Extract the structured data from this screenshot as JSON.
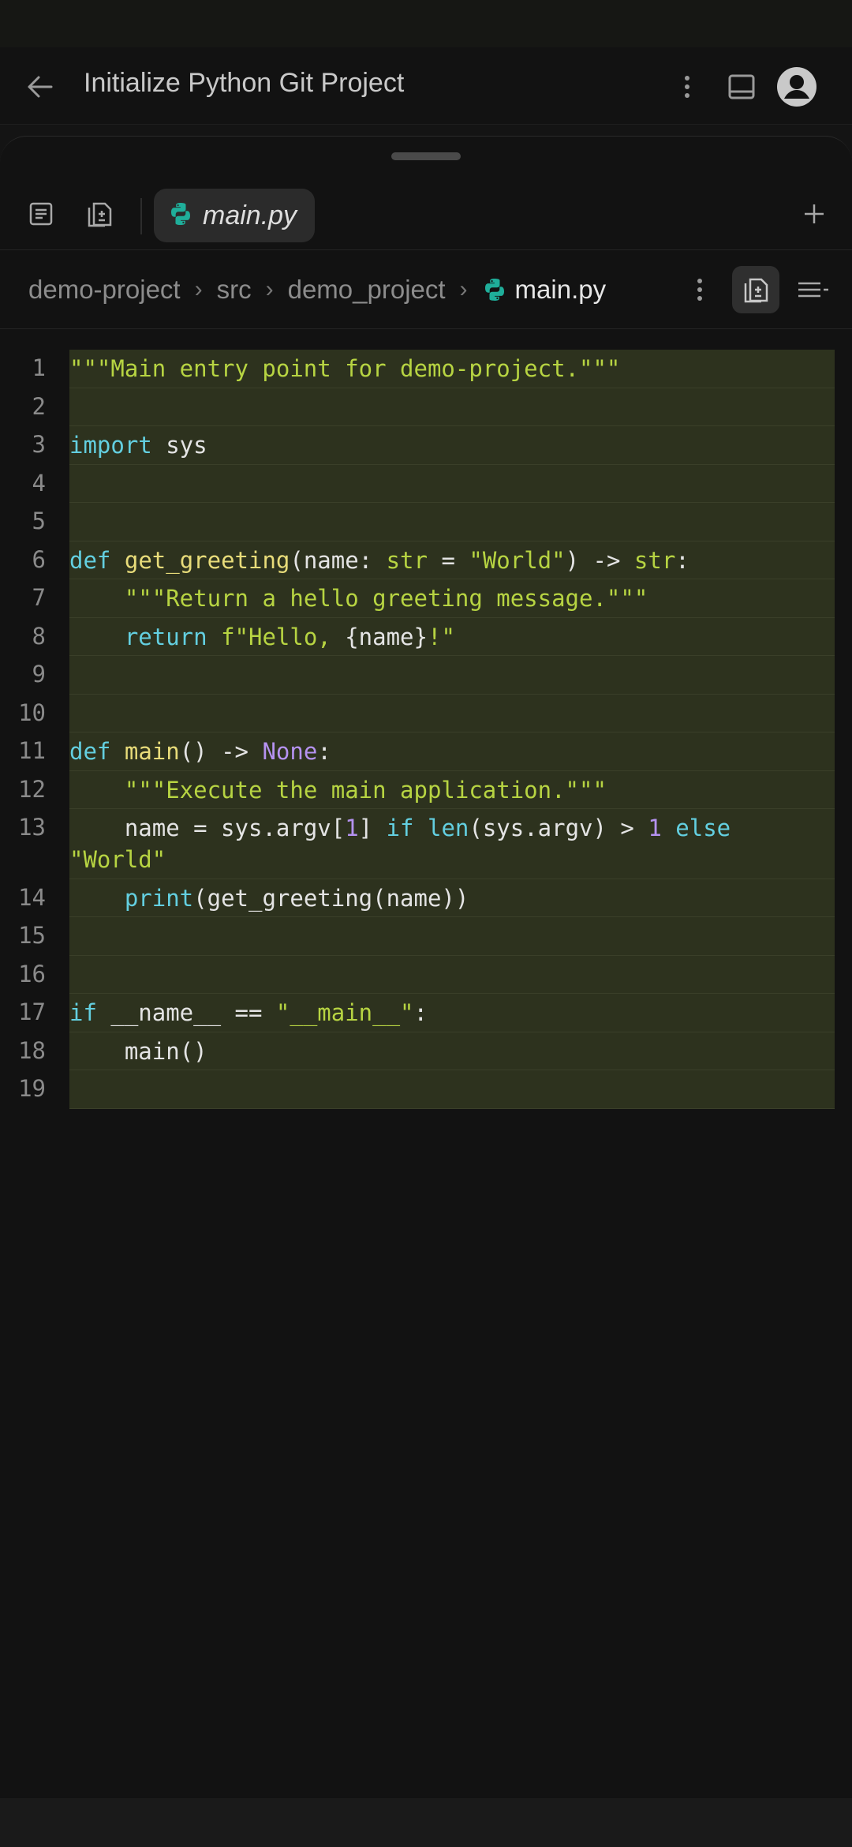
{
  "header": {
    "title": "Initialize Python Git Project",
    "icons": [
      "arrow-left-icon",
      "more-vert-icon",
      "panel-icon",
      "account-circle-icon"
    ]
  },
  "tabs": {
    "icons": [
      "document-icon",
      "diff-file-icon",
      "plus-icon"
    ],
    "active_tab": {
      "label": "main.py",
      "icon": "python-icon"
    }
  },
  "breadcrumb": {
    "items": [
      "demo-project",
      "src",
      "demo_project"
    ],
    "separator": "›",
    "current": "main.py",
    "icons": [
      "python-icon",
      "more-vert-icon",
      "diff-file-icon",
      "outline-icon"
    ]
  },
  "editor": {
    "language": "python",
    "highlight_color": "#2d321e",
    "lines": [
      {
        "n": "1",
        "tokens": [
          {
            "t": "\"\"\"Main entry point for demo-project.\"\"\"",
            "c": "str"
          }
        ]
      },
      {
        "n": "2",
        "tokens": []
      },
      {
        "n": "3",
        "tokens": [
          {
            "t": "import",
            "c": "kw"
          },
          {
            "t": " sys",
            "c": "plain"
          }
        ]
      },
      {
        "n": "4",
        "tokens": []
      },
      {
        "n": "5",
        "tokens": []
      },
      {
        "n": "6",
        "tokens": [
          {
            "t": "def",
            "c": "kw"
          },
          {
            "t": " ",
            "c": "plain"
          },
          {
            "t": "get_greeting",
            "c": "fn"
          },
          {
            "t": "(name: ",
            "c": "plain"
          },
          {
            "t": "str",
            "c": "typ"
          },
          {
            "t": " = ",
            "c": "plain"
          },
          {
            "t": "\"World\"",
            "c": "str"
          },
          {
            "t": ") -> ",
            "c": "plain"
          },
          {
            "t": "str",
            "c": "typ"
          },
          {
            "t": ":",
            "c": "plain"
          }
        ]
      },
      {
        "n": "7",
        "tokens": [
          {
            "t": "    \"\"\"Return a hello greeting message.\"\"\"",
            "c": "str"
          }
        ]
      },
      {
        "n": "8",
        "tokens": [
          {
            "t": "    ",
            "c": "plain"
          },
          {
            "t": "return",
            "c": "kw"
          },
          {
            "t": " ",
            "c": "plain"
          },
          {
            "t": "f\"Hello, ",
            "c": "str"
          },
          {
            "t": "{name}",
            "c": "plain"
          },
          {
            "t": "!\"",
            "c": "str"
          }
        ]
      },
      {
        "n": "9",
        "tokens": []
      },
      {
        "n": "10",
        "tokens": []
      },
      {
        "n": "11",
        "tokens": [
          {
            "t": "def",
            "c": "kw"
          },
          {
            "t": " ",
            "c": "plain"
          },
          {
            "t": "main",
            "c": "fn"
          },
          {
            "t": "() -> ",
            "c": "plain"
          },
          {
            "t": "None",
            "c": "const"
          },
          {
            "t": ":",
            "c": "plain"
          }
        ]
      },
      {
        "n": "12",
        "tokens": [
          {
            "t": "    \"\"\"Execute the main application.\"\"\"",
            "c": "str"
          }
        ]
      },
      {
        "n": "13",
        "tokens": [
          {
            "t": "    name = sys.argv[",
            "c": "plain"
          },
          {
            "t": "1",
            "c": "num"
          },
          {
            "t": "] ",
            "c": "plain"
          },
          {
            "t": "if",
            "c": "kw"
          },
          {
            "t": " ",
            "c": "plain"
          },
          {
            "t": "len",
            "c": "bi"
          },
          {
            "t": "(sys.argv) > ",
            "c": "plain"
          },
          {
            "t": "1",
            "c": "num"
          },
          {
            "t": " ",
            "c": "plain"
          },
          {
            "t": "else",
            "c": "kw"
          },
          {
            "t": " ",
            "c": "plain"
          },
          {
            "t": "\"World\"",
            "c": "str"
          }
        ]
      },
      {
        "n": "14",
        "tokens": [
          {
            "t": "    ",
            "c": "plain"
          },
          {
            "t": "print",
            "c": "bi"
          },
          {
            "t": "(get_greeting(name))",
            "c": "plain"
          }
        ]
      },
      {
        "n": "15",
        "tokens": []
      },
      {
        "n": "16",
        "tokens": []
      },
      {
        "n": "17",
        "tokens": [
          {
            "t": "if",
            "c": "kw"
          },
          {
            "t": " __name__ == ",
            "c": "plain"
          },
          {
            "t": "\"__main__\"",
            "c": "str"
          },
          {
            "t": ":",
            "c": "plain"
          }
        ]
      },
      {
        "n": "18",
        "tokens": [
          {
            "t": "    main()",
            "c": "plain"
          }
        ]
      },
      {
        "n": "19",
        "tokens": []
      }
    ]
  }
}
